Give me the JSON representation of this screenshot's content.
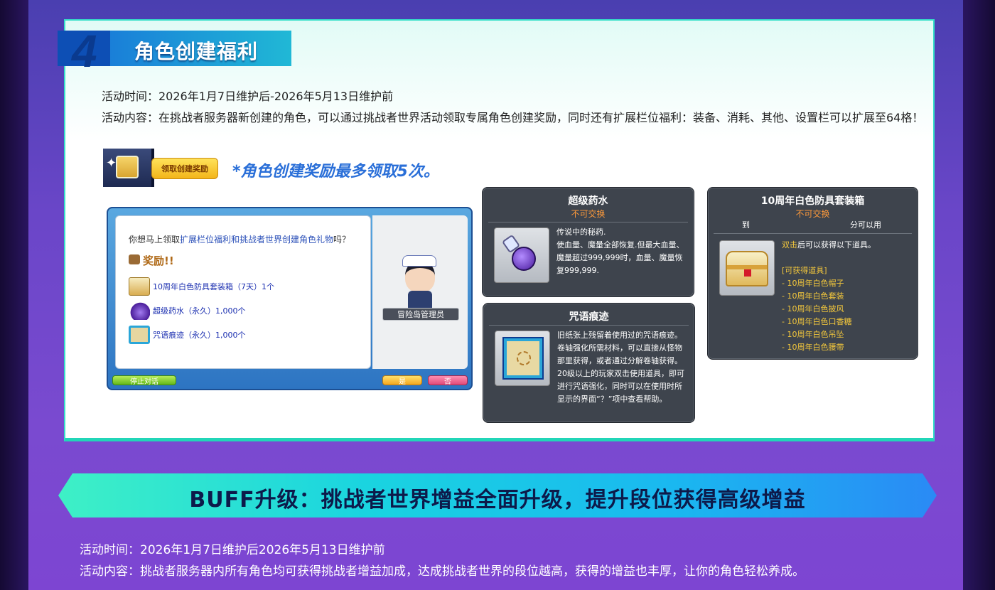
{
  "section4": {
    "number": "4",
    "title": "角色创建福利",
    "time_line": "活动时间：2026年1月7日维护后-2026年5月13日维护前",
    "content_line": "活动内容：在挑战者服务器新创建的角色，可以通过挑战者世界活动领取专属角色创建奖励，同时还有扩展栏位福利：装备、消耗、其他、设置栏可以扩展至64格！",
    "claim_label": "领取创建奖励",
    "claim_note": "*角色创建奖励最多领取5次。"
  },
  "dialog": {
    "question_prefix": "你想马上领取",
    "question_highlight": "扩展栏位福利和挑战者世界创建角色礼物",
    "question_suffix": "吗？",
    "reward_title": "奖励!!",
    "items": [
      {
        "label": "10周年白色防具套装箱（7天）1个",
        "icon": "chest-icon"
      },
      {
        "label": "超级药水（永久）1,000个",
        "icon": "potion-icon"
      },
      {
        "label": "咒语痕迹（永久）1,000个",
        "icon": "scroll-icon"
      }
    ],
    "npc_name": "冒险岛管理员",
    "stop_label": "停止对话",
    "yes_label": "是",
    "no_label": "否"
  },
  "card_potion": {
    "title": "超级药水",
    "sub": "不可交换",
    "desc": "传说中的秘药.\n使血量、魔量全部恢复.但最大血量、魔量超过999,999时，血量、魔量恢复999,999."
  },
  "card_scroll": {
    "title": "咒语痕迹",
    "desc": "旧纸张上残留着使用过的咒语痕迹。卷轴强化所需材料，可以直接从怪物那里获得，或者通过分解卷轴获得。20级以上的玩家双击使用道具，即可进行咒语强化，同时可以在使用时所显示的界面“？”项中查看帮助。"
  },
  "card_chest": {
    "title": "10周年白色防具套装箱",
    "sub": "不可交换",
    "col_left": "到",
    "col_right": "分可以用",
    "desc_hl": "双击",
    "desc_rest": "后可以获得以下道具。",
    "list_title": "[可获得道具]",
    "list": [
      "- 10周年白色帽子",
      "- 10周年白色套装",
      "- 10周年白色披风",
      "- 10周年白色口香糖",
      "- 10周年白色吊坠",
      "- 10周年白色腰带"
    ]
  },
  "banner": {
    "text": "BUFF升级：挑战者世界增益全面升级，提升段位获得高级增益"
  },
  "buff": {
    "time_line": "活动时间：2026年1月7日维护后2026年5月13日维护前",
    "content_line": "活动内容：挑战者服务器内所有角色均可获得挑战者增益加成，达成挑战者世界的段位越高，获得的增益也丰厚，让你的角色轻松养成。"
  }
}
